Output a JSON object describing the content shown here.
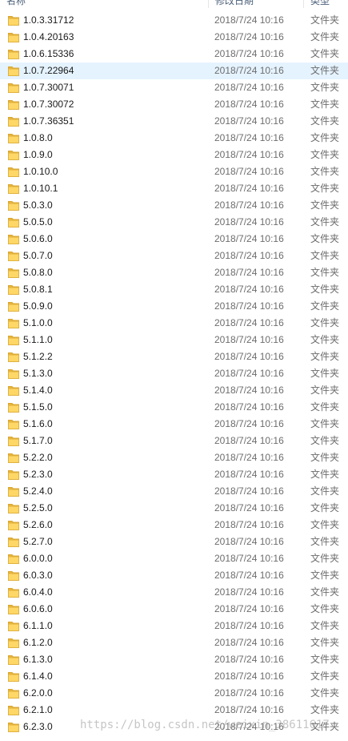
{
  "header": {
    "name_label": "名称",
    "date_label": "修改日期",
    "type_label": "类型"
  },
  "icon": "folder-icon",
  "folder_color": "#ffd766",
  "selected_color": "#e5f3ff",
  "rows": [
    {
      "name": "1.0.3.31712",
      "date": "2018/7/24 10:16",
      "type": "文件夹"
    },
    {
      "name": "1.0.4.20163",
      "date": "2018/7/24 10:16",
      "type": "文件夹"
    },
    {
      "name": "1.0.6.15336",
      "date": "2018/7/24 10:16",
      "type": "文件夹"
    },
    {
      "name": "1.0.7.22964",
      "date": "2018/7/24 10:16",
      "type": "文件夹",
      "selected": true
    },
    {
      "name": "1.0.7.30071",
      "date": "2018/7/24 10:16",
      "type": "文件夹"
    },
    {
      "name": "1.0.7.30072",
      "date": "2018/7/24 10:16",
      "type": "文件夹"
    },
    {
      "name": "1.0.7.36351",
      "date": "2018/7/24 10:16",
      "type": "文件夹"
    },
    {
      "name": "1.0.8.0",
      "date": "2018/7/24 10:16",
      "type": "文件夹"
    },
    {
      "name": "1.0.9.0",
      "date": "2018/7/24 10:16",
      "type": "文件夹"
    },
    {
      "name": "1.0.10.0",
      "date": "2018/7/24 10:16",
      "type": "文件夹"
    },
    {
      "name": "1.0.10.1",
      "date": "2018/7/24 10:16",
      "type": "文件夹"
    },
    {
      "name": "5.0.3.0",
      "date": "2018/7/24 10:16",
      "type": "文件夹"
    },
    {
      "name": "5.0.5.0",
      "date": "2018/7/24 10:16",
      "type": "文件夹"
    },
    {
      "name": "5.0.6.0",
      "date": "2018/7/24 10:16",
      "type": "文件夹"
    },
    {
      "name": "5.0.7.0",
      "date": "2018/7/24 10:16",
      "type": "文件夹"
    },
    {
      "name": "5.0.8.0",
      "date": "2018/7/24 10:16",
      "type": "文件夹"
    },
    {
      "name": "5.0.8.1",
      "date": "2018/7/24 10:16",
      "type": "文件夹"
    },
    {
      "name": "5.0.9.0",
      "date": "2018/7/24 10:16",
      "type": "文件夹"
    },
    {
      "name": "5.1.0.0",
      "date": "2018/7/24 10:16",
      "type": "文件夹"
    },
    {
      "name": "5.1.1.0",
      "date": "2018/7/24 10:16",
      "type": "文件夹"
    },
    {
      "name": "5.1.2.2",
      "date": "2018/7/24 10:16",
      "type": "文件夹"
    },
    {
      "name": "5.1.3.0",
      "date": "2018/7/24 10:16",
      "type": "文件夹"
    },
    {
      "name": "5.1.4.0",
      "date": "2018/7/24 10:16",
      "type": "文件夹"
    },
    {
      "name": "5.1.5.0",
      "date": "2018/7/24 10:16",
      "type": "文件夹"
    },
    {
      "name": "5.1.6.0",
      "date": "2018/7/24 10:16",
      "type": "文件夹"
    },
    {
      "name": "5.1.7.0",
      "date": "2018/7/24 10:16",
      "type": "文件夹"
    },
    {
      "name": "5.2.2.0",
      "date": "2018/7/24 10:16",
      "type": "文件夹"
    },
    {
      "name": "5.2.3.0",
      "date": "2018/7/24 10:16",
      "type": "文件夹"
    },
    {
      "name": "5.2.4.0",
      "date": "2018/7/24 10:16",
      "type": "文件夹"
    },
    {
      "name": "5.2.5.0",
      "date": "2018/7/24 10:16",
      "type": "文件夹"
    },
    {
      "name": "5.2.6.0",
      "date": "2018/7/24 10:16",
      "type": "文件夹"
    },
    {
      "name": "5.2.7.0",
      "date": "2018/7/24 10:16",
      "type": "文件夹"
    },
    {
      "name": "6.0.0.0",
      "date": "2018/7/24 10:16",
      "type": "文件夹"
    },
    {
      "name": "6.0.3.0",
      "date": "2018/7/24 10:16",
      "type": "文件夹"
    },
    {
      "name": "6.0.4.0",
      "date": "2018/7/24 10:16",
      "type": "文件夹"
    },
    {
      "name": "6.0.6.0",
      "date": "2018/7/24 10:16",
      "type": "文件夹"
    },
    {
      "name": "6.1.1.0",
      "date": "2018/7/24 10:16",
      "type": "文件夹"
    },
    {
      "name": "6.1.2.0",
      "date": "2018/7/24 10:16",
      "type": "文件夹"
    },
    {
      "name": "6.1.3.0",
      "date": "2018/7/24 10:16",
      "type": "文件夹"
    },
    {
      "name": "6.1.4.0",
      "date": "2018/7/24 10:16",
      "type": "文件夹"
    },
    {
      "name": "6.2.0.0",
      "date": "2018/7/24 10:16",
      "type": "文件夹"
    },
    {
      "name": "6.2.1.0",
      "date": "2018/7/24 10:16",
      "type": "文件夹"
    },
    {
      "name": "6.2.3.0",
      "date": "2018/7/24 10:16",
      "type": "文件夹"
    }
  ],
  "watermark": "https://blog.csdn.net/weixin_38611617"
}
